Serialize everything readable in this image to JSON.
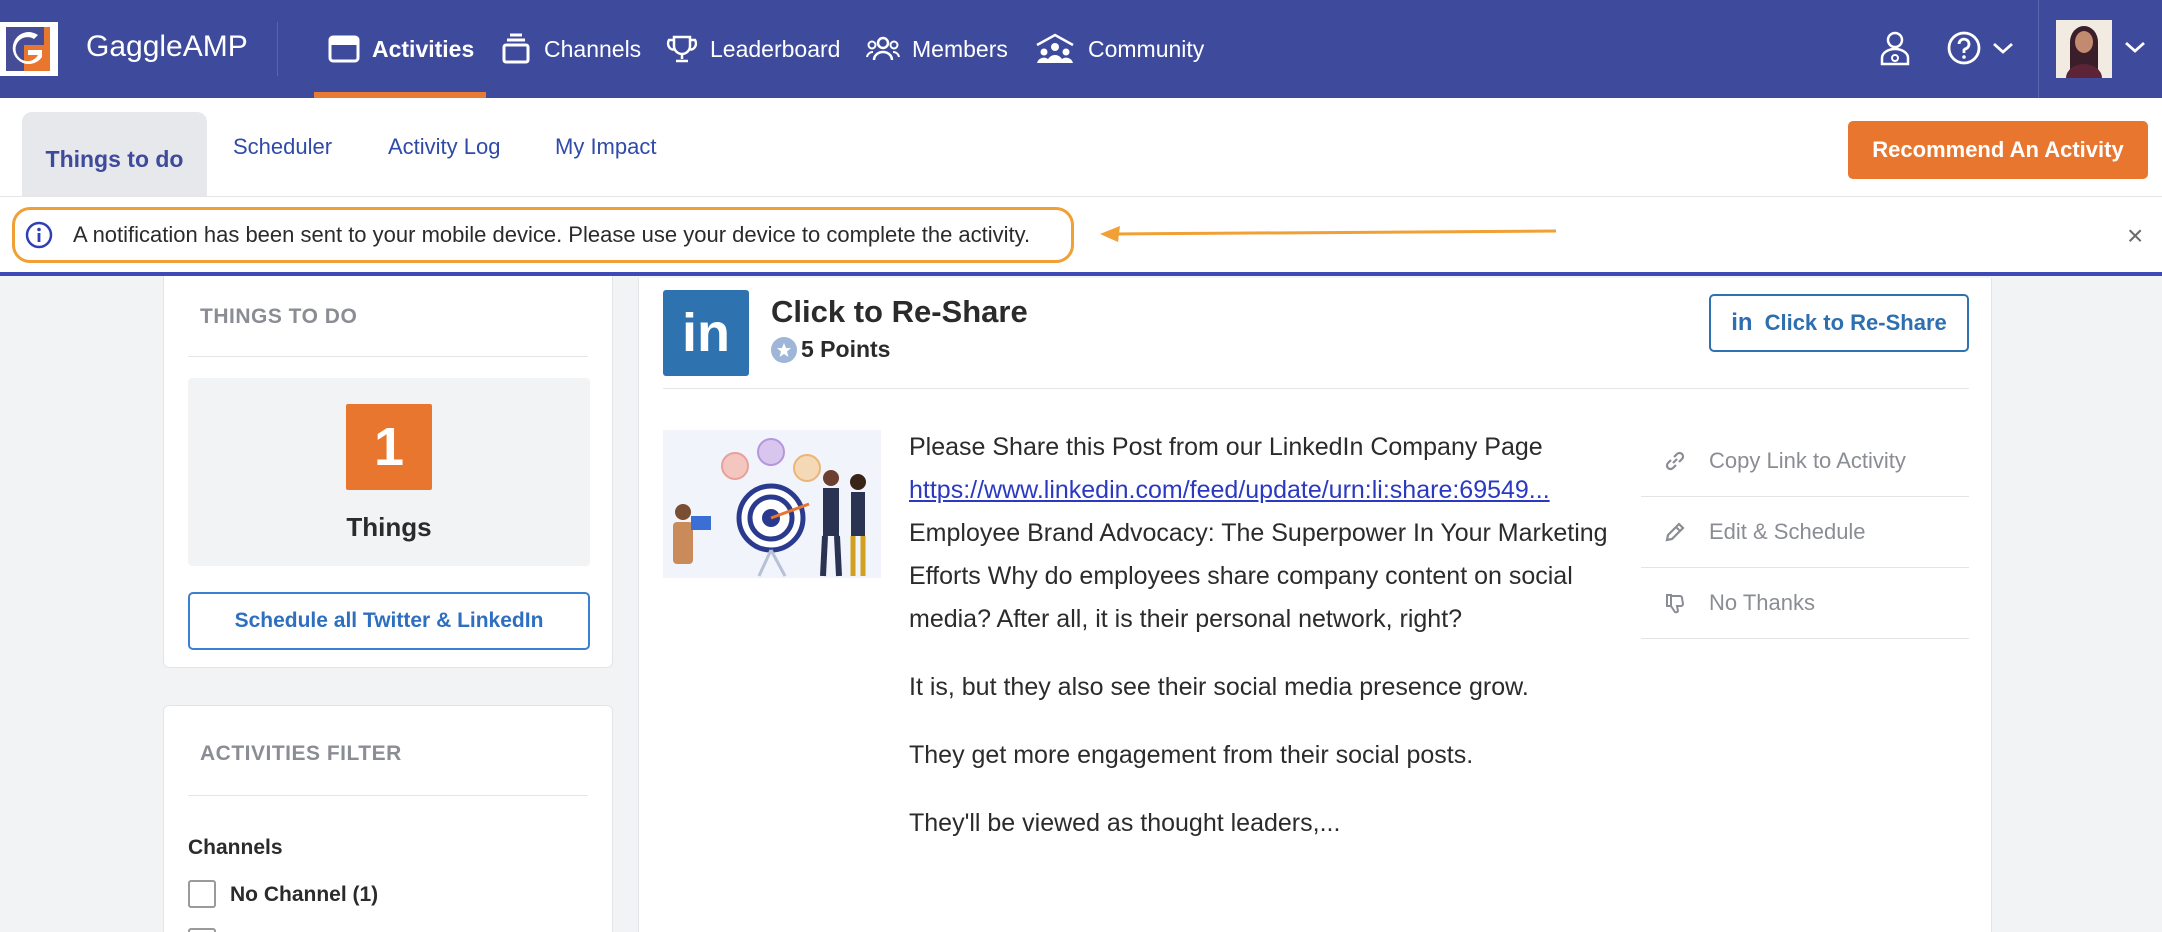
{
  "topbar": {
    "brand": "GaggleAMP",
    "nav": [
      {
        "label": "Activities",
        "icon": "window-icon",
        "active": true
      },
      {
        "label": "Channels",
        "icon": "stack-icon"
      },
      {
        "label": "Leaderboard",
        "icon": "trophy-icon"
      },
      {
        "label": "Members",
        "icon": "members-icon"
      },
      {
        "label": "Community",
        "icon": "community-icon"
      }
    ],
    "accent": "#e87a35",
    "background": "#3e4a9c"
  },
  "subnav": {
    "tabs": [
      {
        "label": "Things to do",
        "active": true
      },
      {
        "label": "Scheduler"
      },
      {
        "label": "Activity Log"
      },
      {
        "label": "My Impact"
      }
    ],
    "recommend_label": "Recommend An Activity"
  },
  "notification": {
    "text": "A notification has been sent to your mobile device. Please use your device to complete the activity.",
    "close": "×"
  },
  "things_to_do": {
    "title": "THINGS TO DO",
    "count": "1",
    "count_label": "Things",
    "schedule_label": "Schedule all Twitter & LinkedIn"
  },
  "filter": {
    "title": "ACTIVITIES FILTER",
    "channels_label": "Channels",
    "channel_items": [
      {
        "label": "No Channel (1)",
        "checked": false
      }
    ]
  },
  "activity": {
    "network_logo": "in",
    "title": "Click to Re-Share",
    "points": "5 Points",
    "reshare_label": "Click to Re-Share",
    "description_line1": "Please Share this Post from our LinkedIn Company Page",
    "link": "https://www.linkedin.com/feed/update/urn:li:share:69549...",
    "description_line2": "Employee Brand Advocacy: The Superpower In Your Marketing Efforts Why do employees share company content on social media? After all, it is their personal network, right?",
    "paragraph2": "It is, but they also see their social media presence grow.",
    "paragraph3": "They get more engagement from their social posts.",
    "paragraph4": "They'll be viewed as thought leaders,...",
    "side_actions": [
      {
        "label": "Copy Link to Activity",
        "icon": "link-icon"
      },
      {
        "label": "Edit & Schedule",
        "icon": "pencil-icon"
      },
      {
        "label": "No Thanks",
        "icon": "thumbs-down-icon"
      }
    ]
  }
}
